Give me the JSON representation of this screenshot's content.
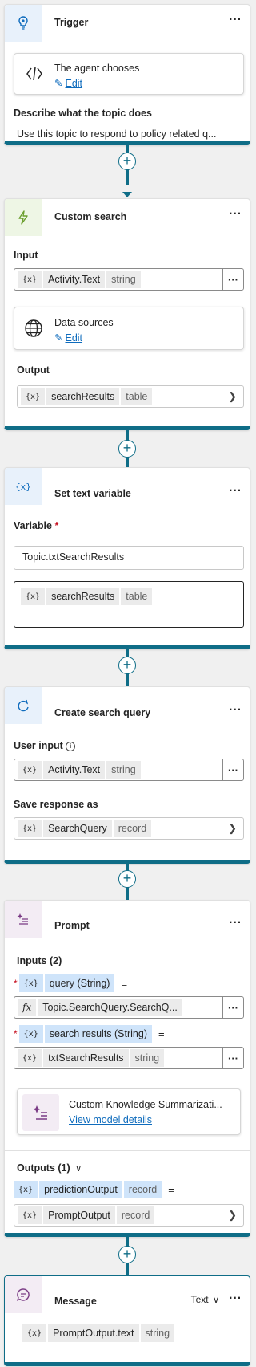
{
  "trigger": {
    "title": "Trigger",
    "agent_card": {
      "title": "The agent chooses",
      "edit": "Edit"
    },
    "describe_label": "Describe what the topic does",
    "describe_value": "Use this topic to respond to policy related q..."
  },
  "custom_search": {
    "title": "Custom search",
    "input_label": "Input",
    "input": {
      "var": "Activity.Text",
      "type": "string"
    },
    "data_sources": {
      "title": "Data sources",
      "edit": "Edit"
    },
    "output_label": "Output",
    "output": {
      "var": "searchResults",
      "type": "table"
    }
  },
  "set_text_variable": {
    "title": "Set text variable",
    "variable_label": "Variable",
    "variable_value": "Topic.txtSearchResults",
    "value": {
      "var": "searchResults",
      "type": "table"
    }
  },
  "create_search_query": {
    "title": "Create search query",
    "user_input_label": "User input",
    "user_input": {
      "var": "Activity.Text",
      "type": "string"
    },
    "save_label": "Save response as",
    "save": {
      "var": "SearchQuery",
      "type": "record"
    }
  },
  "prompt": {
    "title": "Prompt",
    "inputs_label": "Inputs (2)",
    "input1": {
      "name": "query (String)",
      "eq": "=",
      "value": "Topic.SearchQuery.SearchQ..."
    },
    "input2": {
      "name": "search results (String)",
      "eq": "=",
      "value": "txtSearchResults",
      "type": "string"
    },
    "model": {
      "title": "Custom Knowledge Summarizati...",
      "link": "View model details"
    },
    "outputs_label": "Outputs (1)",
    "output": {
      "name": "predictionOutput",
      "type": "record",
      "eq": "="
    },
    "output_value": {
      "var": "PromptOutput",
      "type": "record"
    }
  },
  "message": {
    "title": "Message",
    "mode": "Text",
    "value": {
      "var": "PromptOutput.text",
      "type": "string"
    }
  },
  "common": {
    "x_token": "{x}",
    "fx_token": "fx",
    "more": "···",
    "required": "*"
  }
}
